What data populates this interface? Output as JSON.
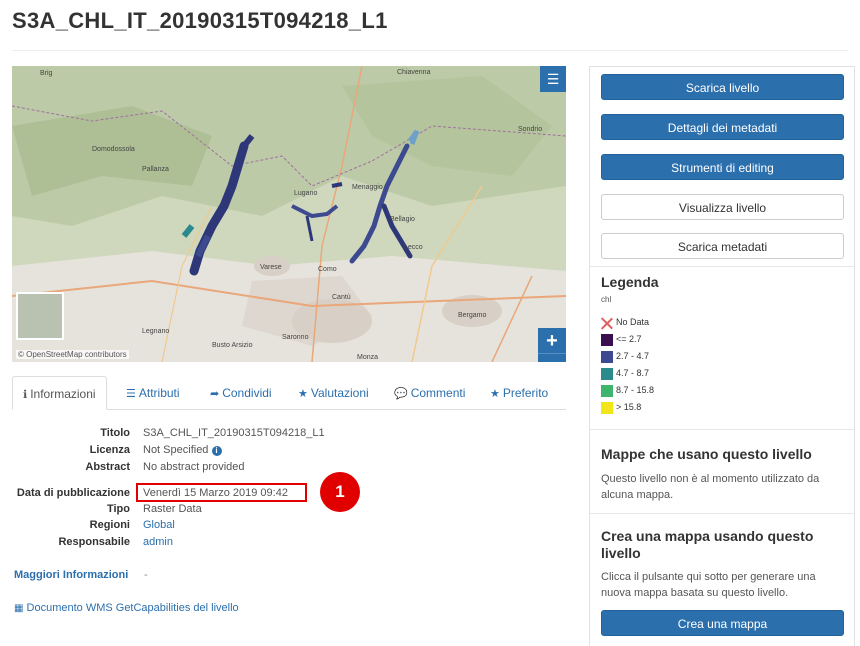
{
  "layer": {
    "title": "S3A_CHL_IT_20190315T094218_L1"
  },
  "map": {
    "attribution": "© OpenStreetMap contributors",
    "labels": [
      "Brig",
      "Domodossola",
      "Lugano",
      "Varese",
      "Como",
      "Lecco",
      "Bergamo",
      "Monza",
      "Menaggio",
      "Bellagio",
      "Chiavenna",
      "Sondrio",
      "Busto Arsizio",
      "Saronno",
      "Cantù",
      "Legnano",
      "Pallanza"
    ],
    "zoom_in": "+",
    "zoom_out": "−",
    "more": "···",
    "menu": "☰"
  },
  "tabs": [
    {
      "icon": "ℹ",
      "label": "Informazioni"
    },
    {
      "icon": "☰",
      "label": "Attributi"
    },
    {
      "icon": "➦",
      "label": "Condividi"
    },
    {
      "icon": "★",
      "label": "Valutazioni"
    },
    {
      "icon": "💬",
      "label": "Commenti"
    },
    {
      "icon": "★",
      "label": "Preferito"
    }
  ],
  "info": {
    "titolo_label": "Titolo",
    "titolo_value": "S3A_CHL_IT_20190315T094218_L1",
    "licenza_label": "Licenza",
    "licenza_value": "Not Specified",
    "abstract_label": "Abstract",
    "abstract_value": "No abstract provided",
    "data_label": "Data di pubblicazione",
    "data_value": "Venerdì 15 Marzo 2019 09:42",
    "tipo_label": "Tipo",
    "tipo_value": "Raster Data",
    "regioni_label": "Regioni",
    "regioni_value": "Global",
    "responsabile_label": "Responsabile",
    "responsabile_value": "admin",
    "more_info": "Maggiori Informazioni",
    "more_info_value": "-",
    "wms_link": "Documento WMS GetCapabilities del livello"
  },
  "callout": {
    "number": "1",
    "color": "#e00000"
  },
  "sidebar": {
    "download_layer": "Scarica livello",
    "metadata_details": "Dettagli dei metadati",
    "editing_tools": "Strumenti di editing",
    "view_layer": "Visualizza livello",
    "download_metadata": "Scarica metadati",
    "legend_title": "Legenda",
    "legend_unit": "chl",
    "legend_items": [
      {
        "label": "No Data",
        "color": ""
      },
      {
        "label": "<= 2.7",
        "color": "#3b0f4f"
      },
      {
        "label": "2.7 - 4.7",
        "color": "#3e4a8f"
      },
      {
        "label": "4.7 - 8.7",
        "color": "#2a8a8c"
      },
      {
        "label": "8.7 - 15.8",
        "color": "#3db56e"
      },
      {
        "label": "> 15.8",
        "color": "#f2e51a"
      }
    ],
    "maps_using_title": "Mappe che usano questo livello",
    "maps_using_text": "Questo livello non è al momento utilizzato da alcuna mappa.",
    "create_map_title": "Crea una mappa usando questo livello",
    "create_map_text": "Clicca il pulsante qui sotto per generare una nuova mappa basata su questo livello.",
    "create_map_button": "Crea una mappa"
  },
  "colors": {
    "primary": "#2c6fad",
    "highlight": "#e00000"
  }
}
